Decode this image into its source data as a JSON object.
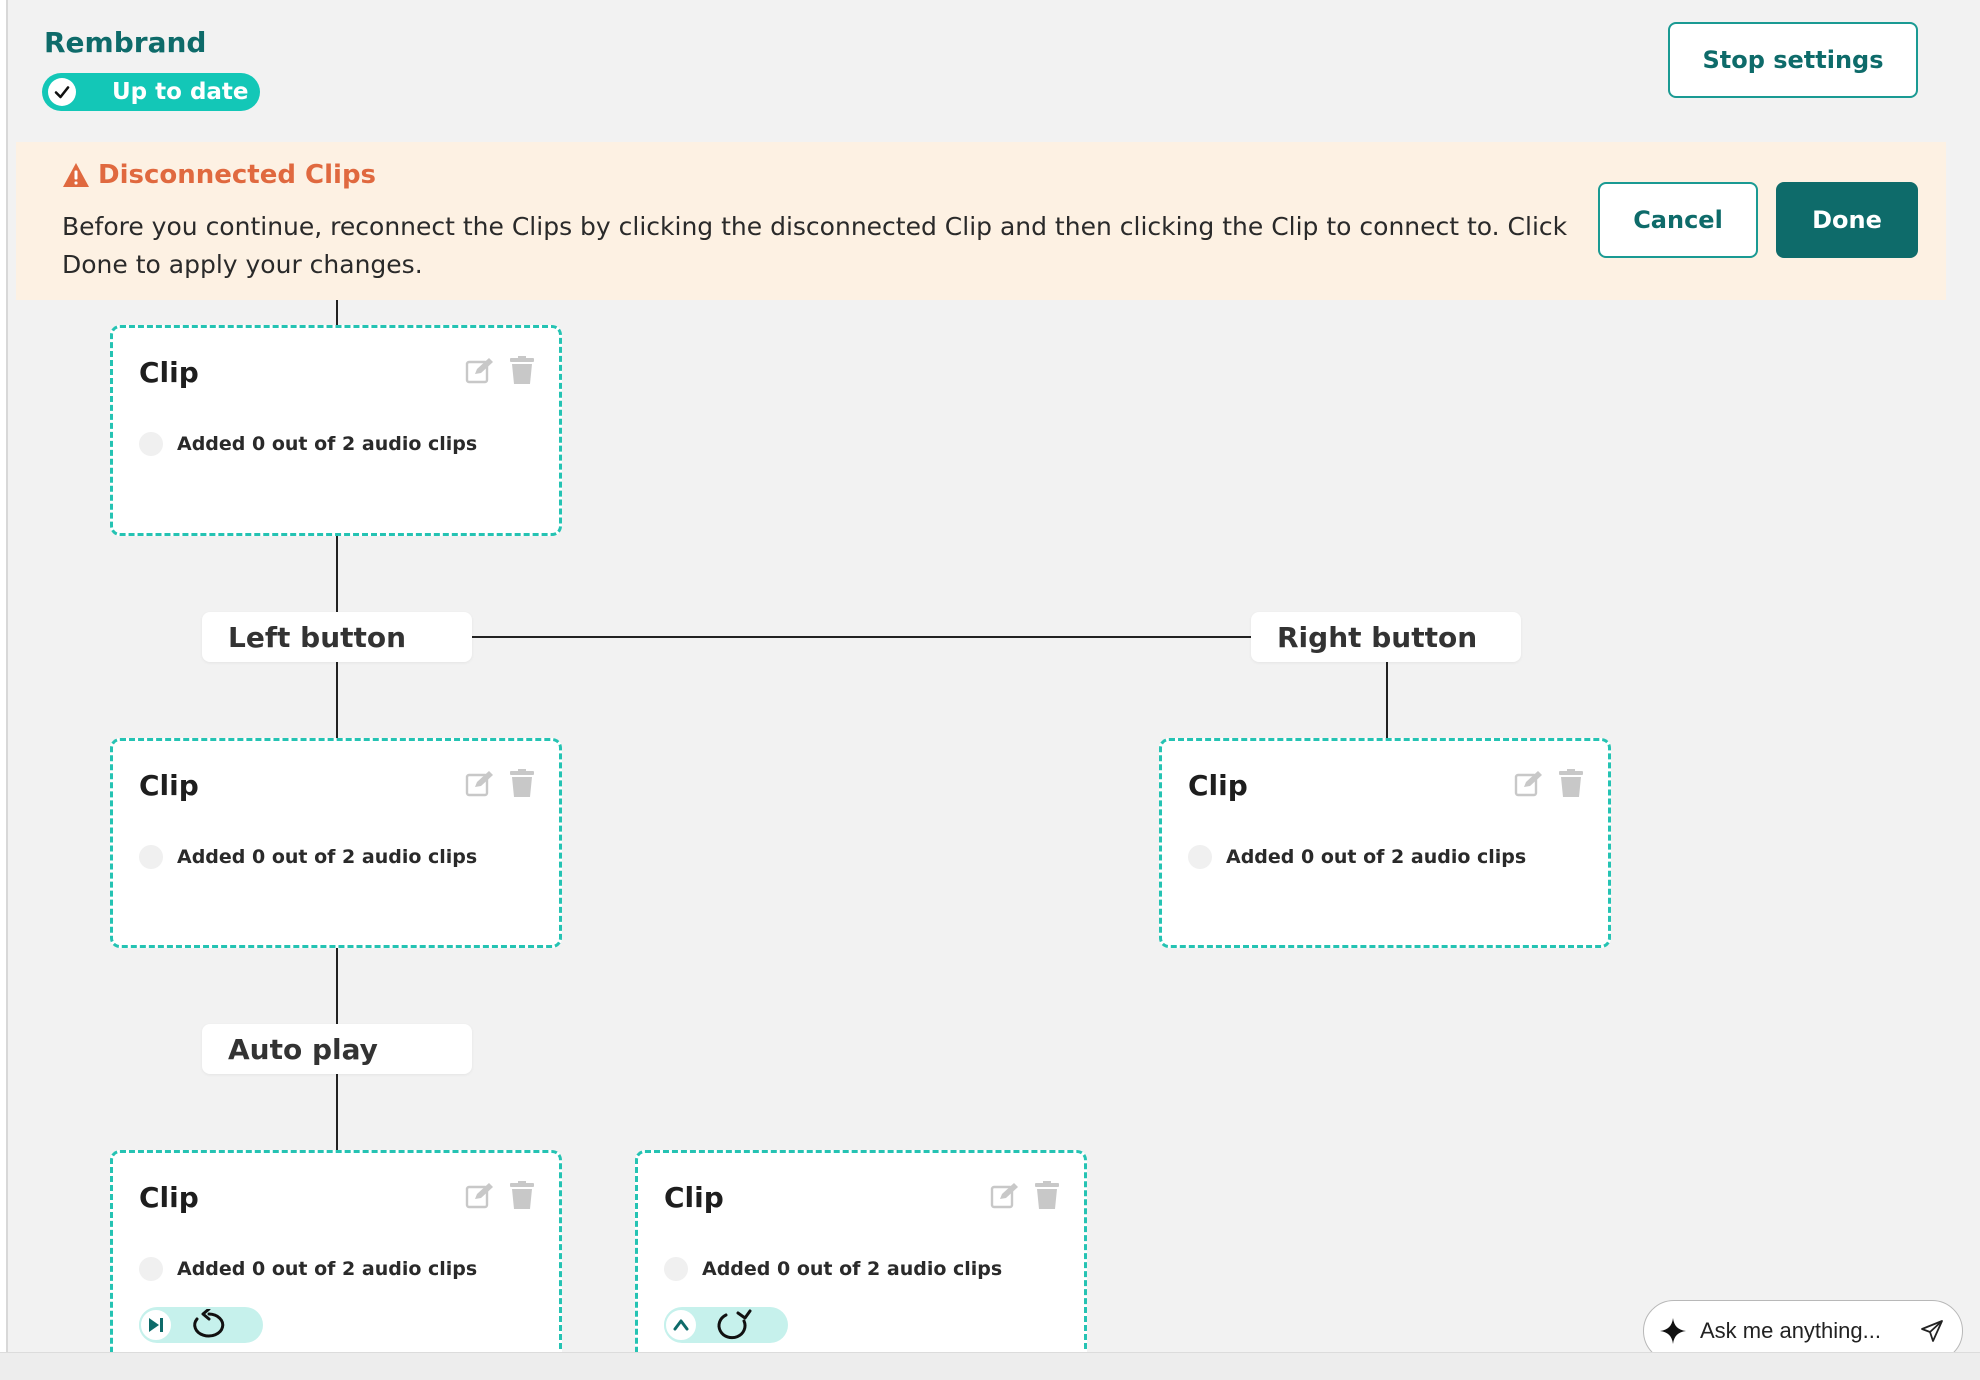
{
  "header": {
    "title": "Rembrand",
    "status": "Up to date",
    "stop_settings_label": "Stop settings"
  },
  "banner": {
    "title": "Disconnected Clips",
    "message": "Before you continue, reconnect the Clips by clicking the disconnected Clip and then clicking the Clip to connect to. Click Done to apply your changes.",
    "cancel_label": "Cancel",
    "done_label": "Done"
  },
  "triggers": {
    "left": "Left button",
    "right": "Right button",
    "auto": "Auto play"
  },
  "clips": [
    {
      "title": "Clip",
      "status": "Added 0 out of 2 audio clips"
    },
    {
      "title": "Clip",
      "status": "Added 0 out of 2 audio clips"
    },
    {
      "title": "Clip",
      "status": "Added 0 out of 2 audio clips"
    },
    {
      "title": "Clip",
      "status": "Added 0 out of 2 audio clips"
    },
    {
      "title": "Clip",
      "status": "Added 0 out of 2 audio clips"
    }
  ],
  "assistant": {
    "placeholder": "Ask me anything..."
  },
  "colors": {
    "brand": "#0e6b6a",
    "accent": "#13c7b7",
    "warning": "#e0693f",
    "banner_bg": "#fdf1e3"
  },
  "icons": {
    "status": "check-icon",
    "warning": "warning-icon",
    "edit": "edit-icon",
    "delete": "trash-icon",
    "next": "skip-next-icon",
    "replay": "replay-icon",
    "up": "chevron-up-icon",
    "redo": "redo-icon",
    "assistant": "sparkle-icon",
    "send": "send-icon"
  }
}
